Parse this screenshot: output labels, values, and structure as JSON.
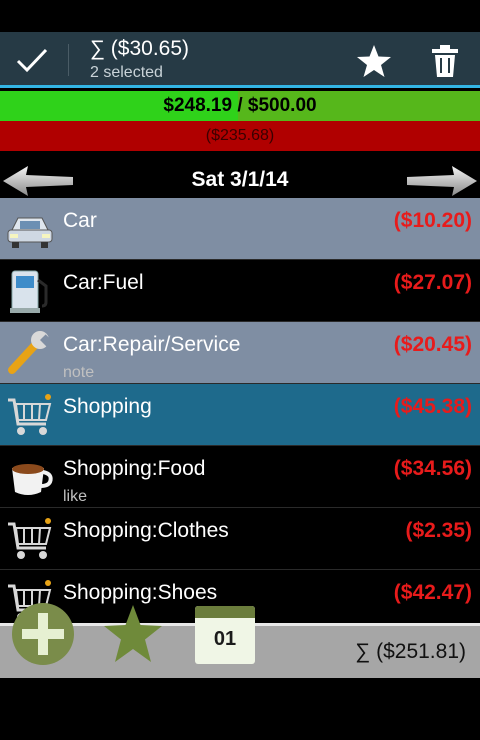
{
  "actionbar": {
    "title": "∑ ($30.65)",
    "subtitle": "2 selected",
    "icons": [
      "check-icon",
      "star-icon",
      "trash-icon"
    ]
  },
  "budget": {
    "text": "$248.19 / $500.00",
    "progress_percent": 49.6,
    "over_text": "($235.68)"
  },
  "datebar": {
    "date": "Sat 3/1/14"
  },
  "items": [
    {
      "name": "Car",
      "note": "",
      "amount": "($10.20)",
      "icon": "car-icon",
      "state": "selected"
    },
    {
      "name": "Car:Fuel",
      "note": "",
      "amount": "($27.07)",
      "icon": "fuel-pump-icon",
      "state": "normal"
    },
    {
      "name": "Car:Repair/Service",
      "note": "note",
      "amount": "($20.45)",
      "icon": "wrench-icon",
      "state": "selected"
    },
    {
      "name": "Shopping",
      "note": "",
      "amount": "($45.38)",
      "icon": "shopping-cart-icon",
      "state": "highlighted"
    },
    {
      "name": "Shopping:Food",
      "note": "like",
      "amount": "($34.56)",
      "icon": "coffee-cup-icon",
      "state": "normal"
    },
    {
      "name": "Shopping:Clothes",
      "note": "",
      "amount": "($2.35)",
      "icon": "shopping-cart-icon",
      "state": "normal"
    },
    {
      "name": "Shopping:Shoes",
      "note": "",
      "amount": "($42.47)",
      "icon": "shopping-cart-icon",
      "state": "normal"
    }
  ],
  "bottombar": {
    "total": "∑ ($251.81)",
    "calendar_day": "01"
  },
  "colors": {
    "actionbar": "#263a45",
    "accent": "#33b5e5",
    "budget_green": "#2fd21a",
    "over_red": "#b00000",
    "amount_red": "#e81b1b",
    "row_selected": "#7f8ea3",
    "row_highlight": "#1e6a8c"
  }
}
